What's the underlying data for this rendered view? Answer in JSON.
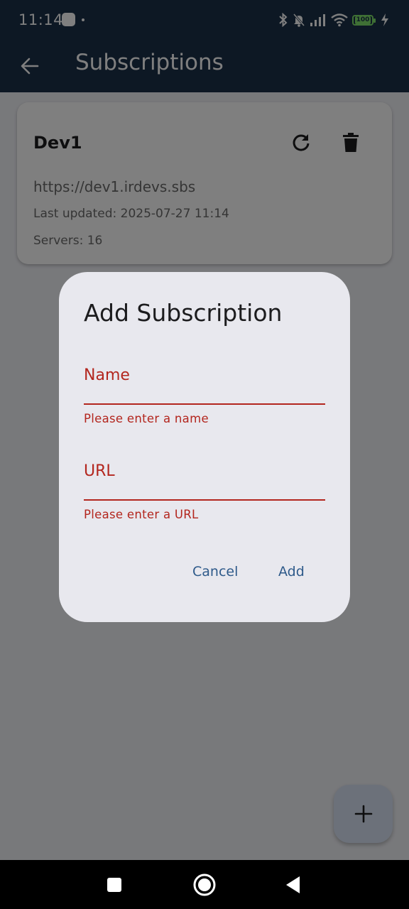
{
  "status_bar": {
    "time": "11:14",
    "battery": "100"
  },
  "app_bar": {
    "title": "Subscriptions"
  },
  "subscription_card": {
    "name": "Dev1",
    "url": "https://dev1.irdevs.sbs",
    "last_updated": "Last updated: 2025-07-27 11:14",
    "servers": "Servers: 16"
  },
  "dialog": {
    "title": "Add Subscription",
    "name_field": {
      "label": "Name",
      "value": "",
      "error": "Please enter a name"
    },
    "url_field": {
      "label": "URL",
      "value": "",
      "error": "Please enter a URL"
    },
    "cancel_label": "Cancel",
    "add_label": "Add"
  },
  "colors": {
    "app_bar": "#1a3048",
    "error": "#b3261e",
    "dialog_button": "#2e5a8a",
    "dialog_background": "#e8e8ee",
    "fab": "#d9e3f5"
  },
  "icons": {
    "back": "arrow-left-icon",
    "refresh": "refresh-icon",
    "delete": "trash-icon",
    "fab": "plus-icon",
    "nav_recents": "square-icon",
    "nav_home": "circle-icon",
    "nav_back": "triangle-icon"
  }
}
